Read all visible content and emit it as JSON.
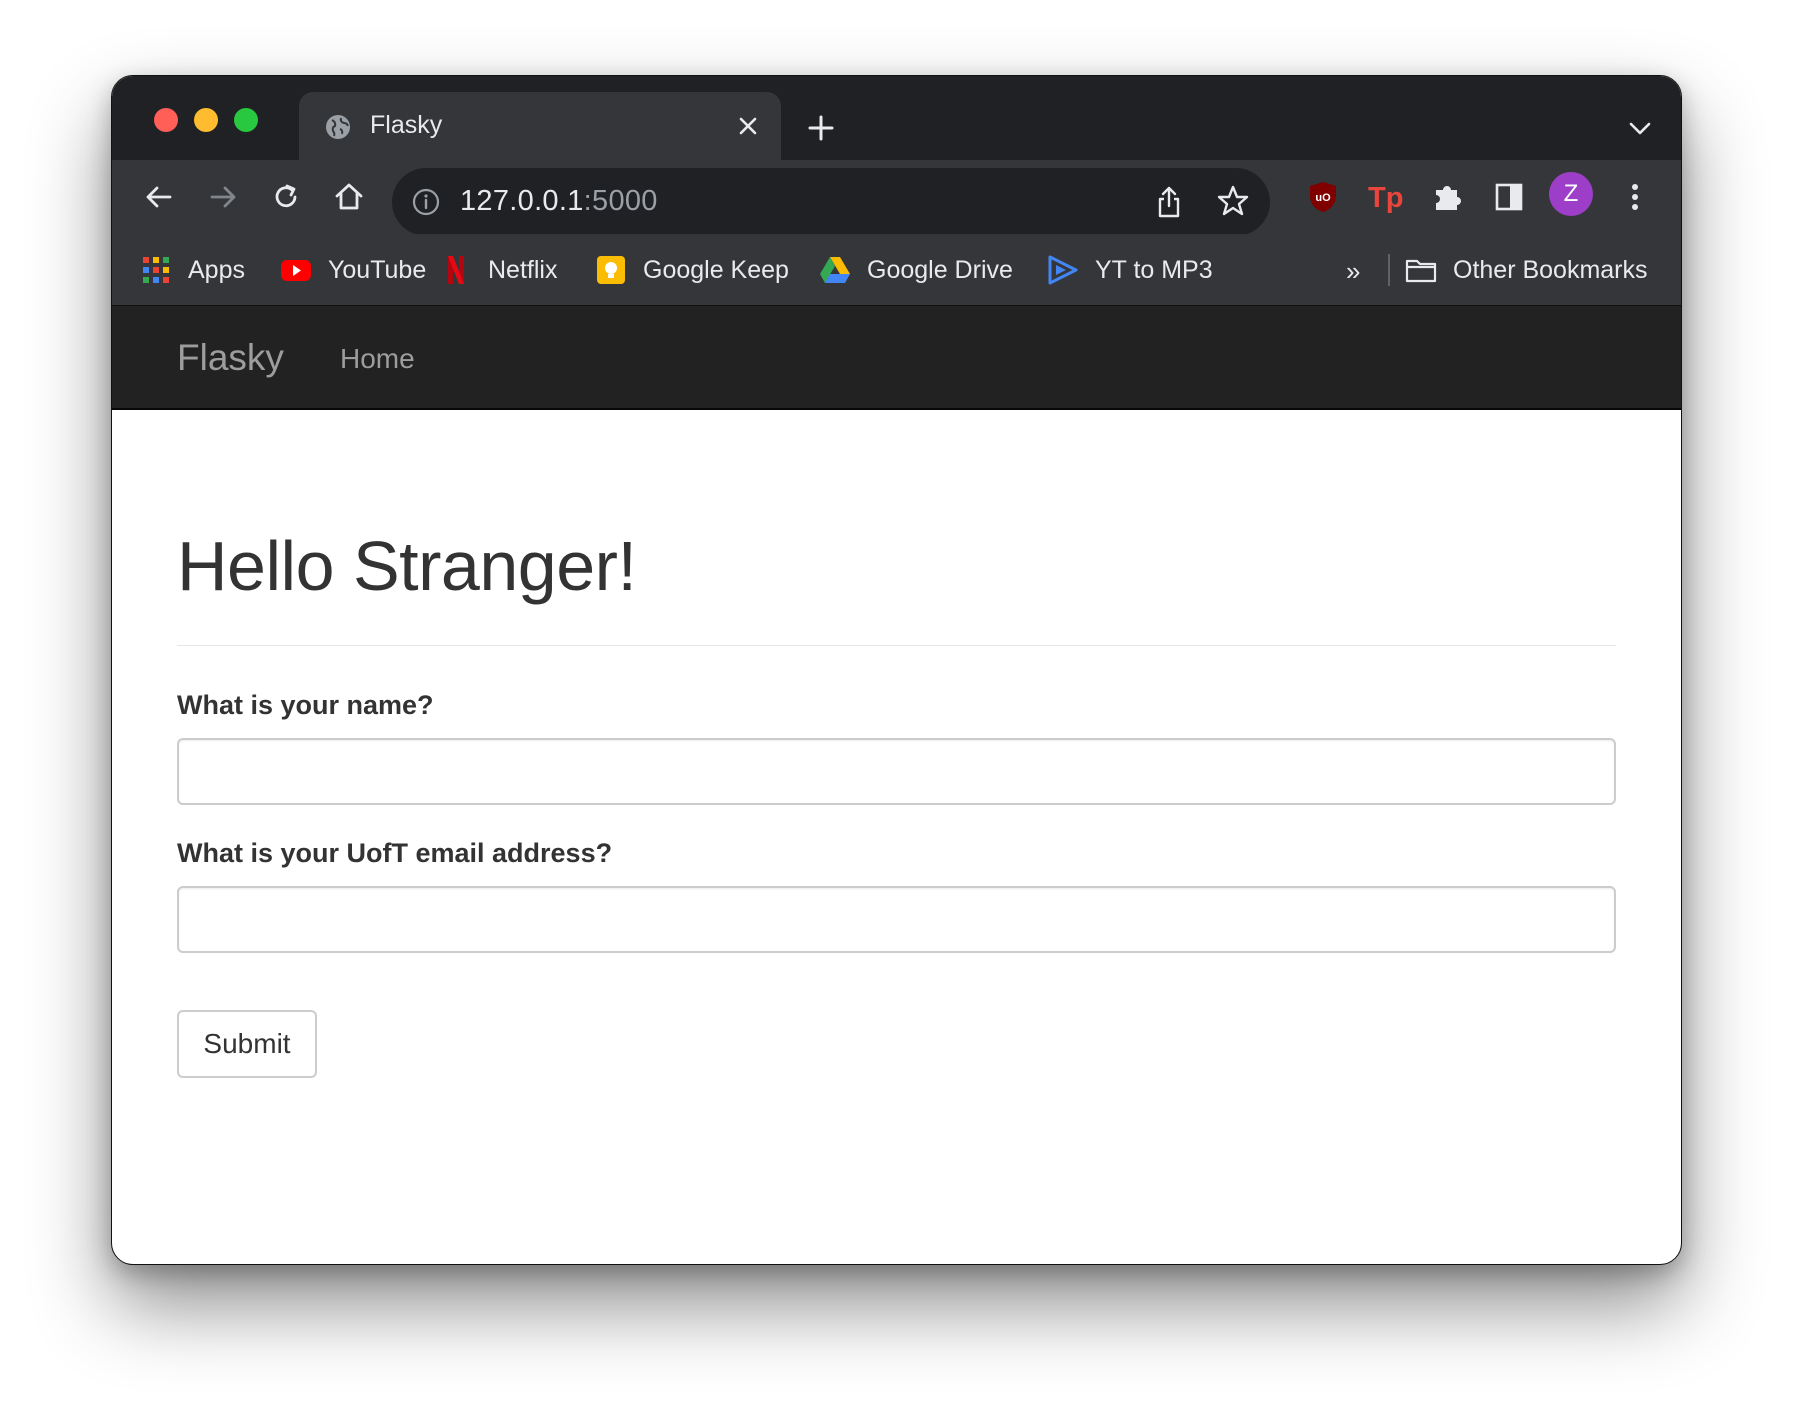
{
  "browser": {
    "tab": {
      "title": "Flasky"
    },
    "address": {
      "host": "127.0.0.1",
      "port": ":5000"
    },
    "profile_initial": "Z",
    "bookmarks": [
      {
        "label": "Apps",
        "icon": "apps-grid-icon"
      },
      {
        "label": "YouTube",
        "icon": "youtube-icon"
      },
      {
        "label": "Netflix",
        "icon": "netflix-icon"
      },
      {
        "label": "Google Keep",
        "icon": "google-keep-icon"
      },
      {
        "label": "Google Drive",
        "icon": "google-drive-icon"
      },
      {
        "label": "YT to MP3",
        "icon": "yt-to-mp3-icon"
      }
    ],
    "overflow": "»",
    "other_bookmarks": "Other Bookmarks"
  },
  "navbar": {
    "brand": "Flasky",
    "links": [
      {
        "label": "Home"
      }
    ]
  },
  "page": {
    "title": "Hello Stranger!",
    "form": {
      "name_label": "What is your name?",
      "name_value": "",
      "email_label": "What is your UofT email address?",
      "email_value": "",
      "submit_label": "Submit"
    }
  },
  "colors": {
    "tabstrip_bg": "#202124",
    "toolbar_bg": "#35363a",
    "navbar_bg": "#222222",
    "avatar_bg": "#9c3ec7"
  }
}
